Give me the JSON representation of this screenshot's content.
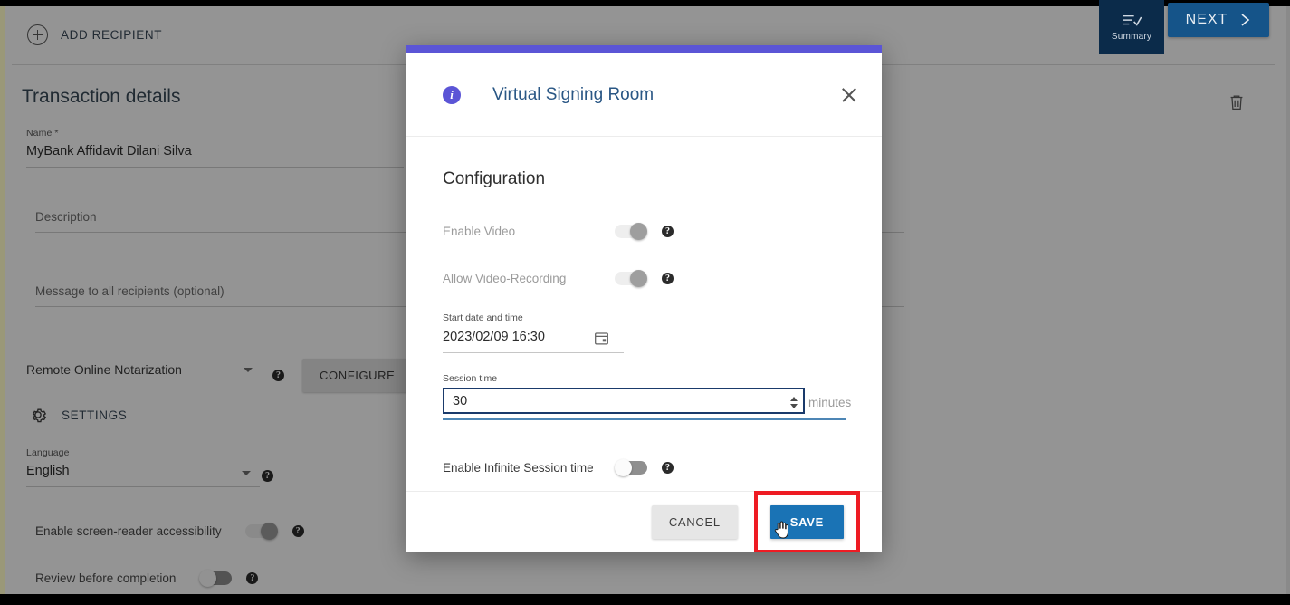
{
  "background": {
    "add_recipient_label": "ADD RECIPIENT",
    "section_title": "Transaction details",
    "name_field": {
      "label": "Name *",
      "value": "MyBank Affidavit Dilani Silva"
    },
    "description_field": {
      "placeholder": "Description",
      "value": ""
    },
    "message_field": {
      "placeholder": "Message to all recipients (optional)",
      "value": ""
    },
    "transaction_type": {
      "selected": "Remote Online Notarization"
    },
    "configure_button": "CONFIGURE",
    "settings_label": "SETTINGS",
    "language_field": {
      "label": "Language",
      "value": "English"
    },
    "toggles": [
      {
        "label": "Enable screen-reader accessibility",
        "state": "on"
      },
      {
        "label": "Review before completion",
        "state": "off"
      }
    ]
  },
  "topbar": {
    "summary_label": "Summary",
    "next_label": "NEXT"
  },
  "dialog": {
    "title": "Virtual Signing Room",
    "heading": "Configuration",
    "rows": [
      {
        "label": "Enable Video",
        "state": "on",
        "disabled": true
      },
      {
        "label": "Allow Video-Recording",
        "state": "on",
        "disabled": true
      }
    ],
    "start_date": {
      "label": "Start date and time",
      "value": "2023/02/09 16:30"
    },
    "session_time": {
      "label": "Session time",
      "value": "30",
      "unit": "minutes"
    },
    "infinite": {
      "label": "Enable Infinite Session time",
      "state": "off"
    },
    "cancel_label": "CANCEL",
    "save_label": "SAVE"
  },
  "colors": {
    "accent_purple": "#5b55d6",
    "dialog_title_blue": "#2a5785",
    "save_blue": "#1a73b5",
    "next_blue": "#155489",
    "summary_navy": "#0b2b4a",
    "highlight_red": "#ee1b23"
  }
}
